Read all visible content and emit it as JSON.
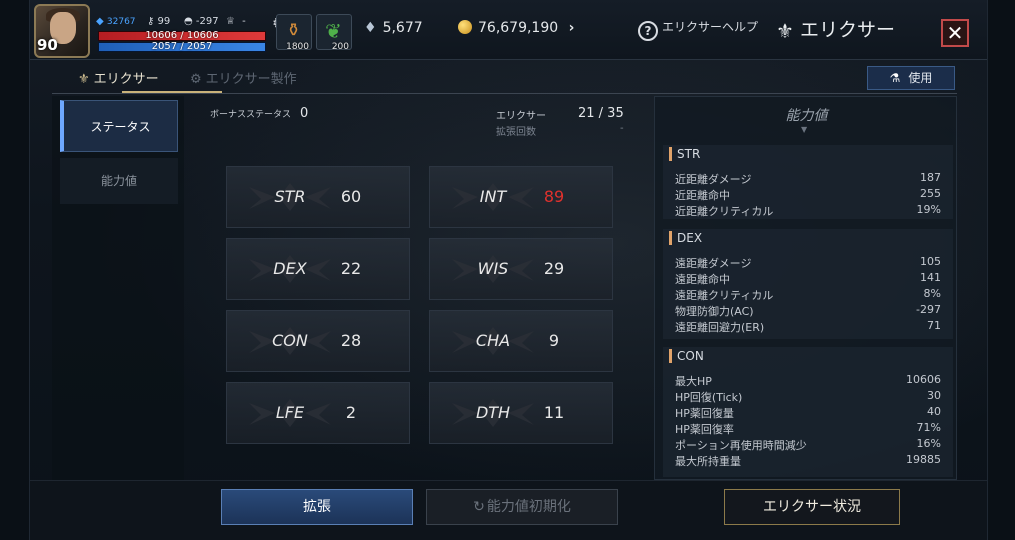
{
  "header": {
    "level": "90",
    "combat_power": "32767",
    "key_count": "99",
    "helmet_value": "-297",
    "trophy_value": "-",
    "hp_text": "10606 / 10606",
    "mp_text": "2057 / 2057",
    "hp_fraction": 1.0,
    "mp_fraction": 1.0,
    "potion_count": "1800",
    "leaf_count": "200",
    "diamonds": "5,677",
    "gold": "76,679,190",
    "help_label": "エリクサーヘルプ",
    "help_glyph": "?",
    "title": "エリクサー",
    "close_glyph": "✕"
  },
  "subtabs": {
    "elixir": "エリクサー",
    "elixir_craft": "エリクサー製作"
  },
  "use_button": "使用",
  "left_menu": {
    "status": "ステータス",
    "ability": "能力値"
  },
  "center": {
    "bonus_label": "ボーナスステータス",
    "bonus_value": "0",
    "elixir_label": "エリクサー",
    "elixir_value": "21 / 35",
    "expansion_label": "拡張回数",
    "expansion_value": "-",
    "stats": [
      {
        "name": "STR",
        "value": "60",
        "color": "#e8e8e8"
      },
      {
        "name": "INT",
        "value": "89",
        "color": "#e0312d"
      },
      {
        "name": "DEX",
        "value": "22",
        "color": "#e8e8e8"
      },
      {
        "name": "WIS",
        "value": "29",
        "color": "#e8e8e8"
      },
      {
        "name": "CON",
        "value": "28",
        "color": "#e8e8e8"
      },
      {
        "name": "CHA",
        "value": "9",
        "color": "#e8e8e8"
      },
      {
        "name": "LFE",
        "value": "2",
        "color": "#e8e8e8"
      },
      {
        "name": "DTH",
        "value": "11",
        "color": "#e8e8e8"
      }
    ]
  },
  "ability_panel": {
    "title": "能力値",
    "sections": [
      {
        "name": "STR",
        "rows": [
          {
            "label": "近距離ダメージ",
            "value": "187"
          },
          {
            "label": "近距離命中",
            "value": "255"
          },
          {
            "label": "近距離クリティカル",
            "value": "19%"
          }
        ]
      },
      {
        "name": "DEX",
        "rows": [
          {
            "label": "遠距離ダメージ",
            "value": "105"
          },
          {
            "label": "遠距離命中",
            "value": "141"
          },
          {
            "label": "遠距離クリティカル",
            "value": "8%"
          },
          {
            "label": "物理防御力(AC)",
            "value": "-297"
          },
          {
            "label": "遠距離回避力(ER)",
            "value": "71"
          }
        ]
      },
      {
        "name": "CON",
        "rows": [
          {
            "label": "最大HP",
            "value": "10606"
          },
          {
            "label": "HP回復(Tick)",
            "value": "30"
          },
          {
            "label": "HP薬回復量",
            "value": "40"
          },
          {
            "label": "HP薬回復率",
            "value": "71%"
          },
          {
            "label": "ポーション再使用時間減少",
            "value": "16%"
          },
          {
            "label": "最大所持重量",
            "value": "19885"
          }
        ]
      }
    ]
  },
  "bottom": {
    "expand": "拡張",
    "reset": "能力値初期化",
    "status": "エリクサー状況"
  }
}
